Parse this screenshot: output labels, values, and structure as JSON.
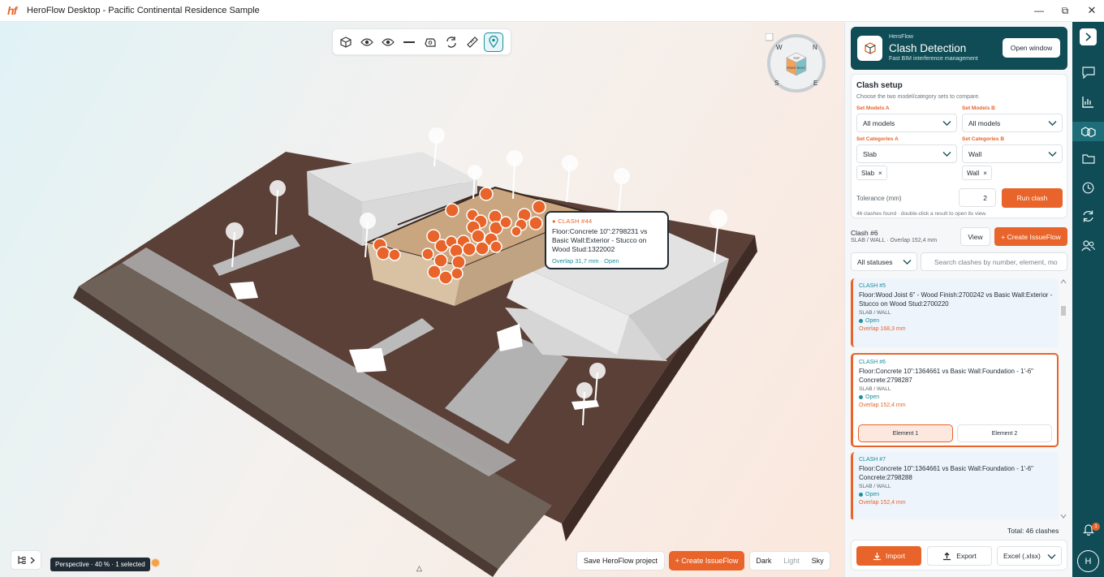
{
  "app": {
    "logo": "hf",
    "title": "HeroFlow Desktop - Pacific Continental Residence Sample"
  },
  "window_controls": {
    "minimize": "—",
    "restore": "⧉",
    "close": "✕"
  },
  "viewport": {
    "toolbar_icons": [
      "cube-icon",
      "eye-icon",
      "eye-alt-icon",
      "line-icon",
      "section-box-icon",
      "rotate-icon",
      "measure-icon",
      "pin-icon"
    ],
    "navcube": {
      "top": "TOP",
      "front": "FRONT",
      "right": "RIGHT",
      "w": "W",
      "n": "N",
      "s": "S",
      "e": "E"
    },
    "tooltip": {
      "label": "CLASH #44",
      "title": "Floor:Concrete 10\":2798231 vs Basic Wall:Exterior - Stucco on Wood Stud:1322002",
      "meta": "Overlap 31,7 mm · Open"
    },
    "status": "Perspective · 40 % · 1 selected",
    "save_project": "Save HeroFlow project",
    "create_issue": "+ Create IssueFlow",
    "themes": [
      "Dark",
      "Light",
      "Sky"
    ],
    "colors": {
      "clash": "#e8642a",
      "ground": "#5a4037",
      "roof": "#dcdcdc"
    }
  },
  "panel": {
    "header": {
      "small": "HeroFlow",
      "title": "Clash Detection",
      "subtitle": "Fast BIM interference management",
      "open_window": "Open window"
    },
    "setup": {
      "title": "Clash setup",
      "hint": "Choose the two model/category sets to compare.",
      "models_a_label": "Set Models A",
      "models_a_value": "All models",
      "models_b_label": "Set Models B",
      "models_b_value": "All models",
      "cats_a_label": "Set Categories A",
      "cats_a_value": "Slab",
      "cats_b_label": "Set Categories B",
      "cats_b_value": "Wall",
      "tag_a": "Slab",
      "tag_b": "Wall",
      "tolerance_label": "Tolerance (mm)",
      "tolerance_value": "2",
      "run": "Run clash",
      "found": "46 clashes found · double-click a result to open its view."
    },
    "selected": {
      "name": "Clash #6",
      "sub": "SLAB / WALL · Overlap 152,4 mm",
      "view": "View",
      "create": "+ Create IssueFlow"
    },
    "filter": {
      "status": "All statuses",
      "search_placeholder": "Search clashes by number, element, mo"
    },
    "clashes": [
      {
        "num": "CLASH #5",
        "title": "Floor:Wood Joist 6\" - Wood Finish:2700242 vs Basic Wall:Exterior - Stucco on Wood Stud:2700220",
        "cat": "SLAB / WALL",
        "status": "Open",
        "overlap": "Overlap 168,3 mm"
      },
      {
        "num": "CLASH #6",
        "title": "Floor:Concrete 10\":1364661 vs Basic Wall:Foundation - 1'-6\" Concrete:2798287",
        "cat": "SLAB / WALL",
        "status": "Open",
        "overlap": "Overlap 152,4 mm",
        "el1": "Element 1",
        "el2": "Element 2"
      },
      {
        "num": "CLASH #7",
        "title": "Floor:Concrete 10\":1364661 vs Basic Wall:Foundation - 1'-6\" Concrete:2798288",
        "cat": "SLAB / WALL",
        "status": "Open",
        "overlap": "Overlap 152,4 mm"
      }
    ],
    "total": "Total: 46 clashes",
    "import": "Import",
    "export": "Export",
    "format": "Excel (.xlsx)"
  },
  "rail": {
    "icons": [
      "chevron-right-icon",
      "comment-icon",
      "chart-icon",
      "clash-icon",
      "folder-icon",
      "history-icon",
      "sync-icon",
      "users-icon"
    ],
    "notifications": "1",
    "avatar": "H"
  }
}
